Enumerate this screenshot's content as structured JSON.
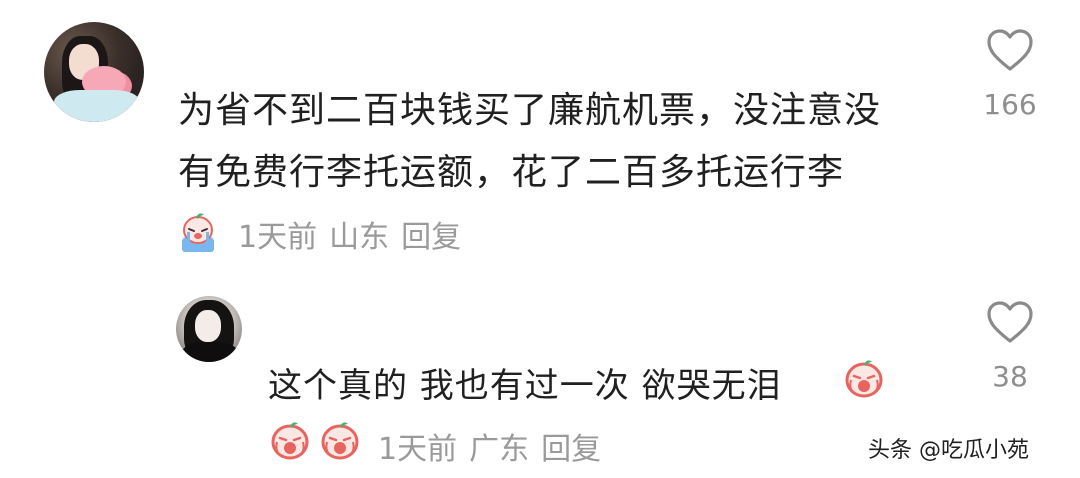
{
  "comment": {
    "text_line1": "为省不到二百块钱买了廉航机票，没注意没",
    "text_line2": "有免费行李托运额，花了二百多托运行李",
    "time": "1天前",
    "location": "山东",
    "reply_label": "回复",
    "likes": "166",
    "icons": [
      "avatar",
      "crying-face-emoji",
      "heart-icon"
    ]
  },
  "reply": {
    "text": "这个真的 我也有过一次 欲哭无泪",
    "time": "1天前",
    "location": "广东",
    "reply_label": "回复",
    "likes": "38",
    "icons": [
      "avatar",
      "sobbing-emoji",
      "heart-icon"
    ]
  },
  "watermark": "头条 @吃瓜小苑",
  "colors": {
    "text": "#202020",
    "meta": "#9a9a9a",
    "emoji_red": "#e8645e",
    "emoji_skin": "#fbe7e3"
  }
}
